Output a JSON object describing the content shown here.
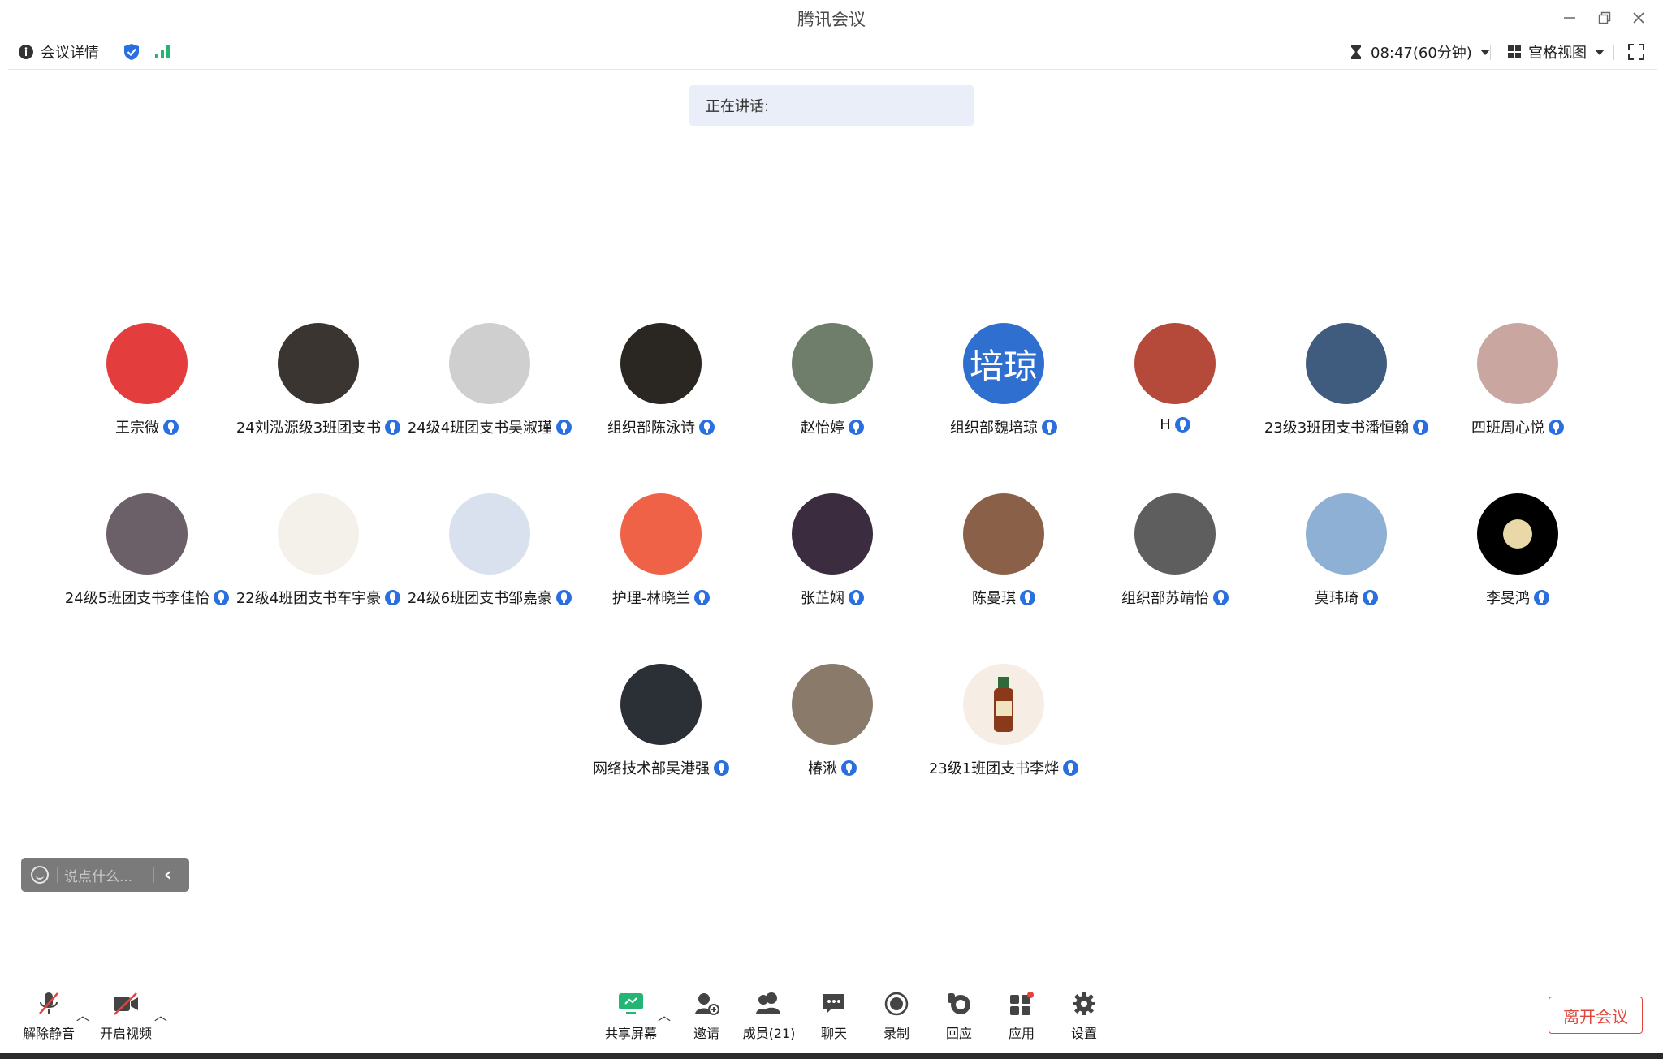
{
  "app": {
    "title": "腾讯会议"
  },
  "toolbar": {
    "details_label": "会议详情",
    "timer": "08:47(60分钟)",
    "view_label": "宫格视图"
  },
  "speaking": {
    "label": "正在讲话:"
  },
  "participants": [
    {
      "name": "王宗微",
      "avatar_color": "#e33d3d"
    },
    {
      "name": "24刘泓源级3班团支书",
      "avatar_color": "#3a3530"
    },
    {
      "name": "24级4班团支书吴淑瑾",
      "avatar_color": "#cfcfcf"
    },
    {
      "name": "组织部陈泳诗",
      "avatar_color": "#2a2622"
    },
    {
      "name": "赵怡婷",
      "avatar_color": "#6f7e6a"
    },
    {
      "name": "组织部魏培琼",
      "avatar_color": "#2f6fcf",
      "avatar_text": "培琼"
    },
    {
      "name": "H",
      "avatar_color": "#b54a3a"
    },
    {
      "name": "23级3班团支书潘恒翰",
      "avatar_color": "#3f5b7e"
    },
    {
      "name": "四班周心悦",
      "avatar_color": "#c9a6a0"
    },
    {
      "name": "24级5班团支书李佳怡",
      "avatar_color": "#6b5f68"
    },
    {
      "name": "22级4班团支书车宇豪",
      "avatar_color": "#f3f1ea"
    },
    {
      "name": "24级6班团支书邹嘉豪",
      "avatar_color": "#d9e1ef"
    },
    {
      "name": "护理-林晓兰",
      "avatar_color": "#ef6248"
    },
    {
      "name": "张芷娴",
      "avatar_color": "#3b2c3f"
    },
    {
      "name": "陈曼琪",
      "avatar_color": "#8b6048"
    },
    {
      "name": "组织部苏靖怡",
      "avatar_color": "#5e5e5e"
    },
    {
      "name": "莫玮琦",
      "avatar_color": "#8db0d4"
    },
    {
      "name": "李旻鸿",
      "avatar_color": "#000000"
    },
    {
      "name": "网络技术部吴港强",
      "avatar_color": "#2b2f36"
    },
    {
      "name": "椿湫",
      "avatar_color": "#8a7a6a"
    },
    {
      "name": "23级1班团支书李烨",
      "avatar_color": "#f6ede4"
    }
  ],
  "chat": {
    "placeholder": "说点什么..."
  },
  "bottombar": {
    "unmute": "解除静音",
    "start_video": "开启视频",
    "share_screen": "共享屏幕",
    "invite": "邀请",
    "members": "成员(21)",
    "chat": "聊天",
    "record": "录制",
    "react": "回应",
    "apps": "应用",
    "settings": "设置",
    "leave": "离开会议"
  },
  "colors": {
    "accent": "#2a6fe0",
    "danger": "#e0463c",
    "signal": "#22b573"
  }
}
